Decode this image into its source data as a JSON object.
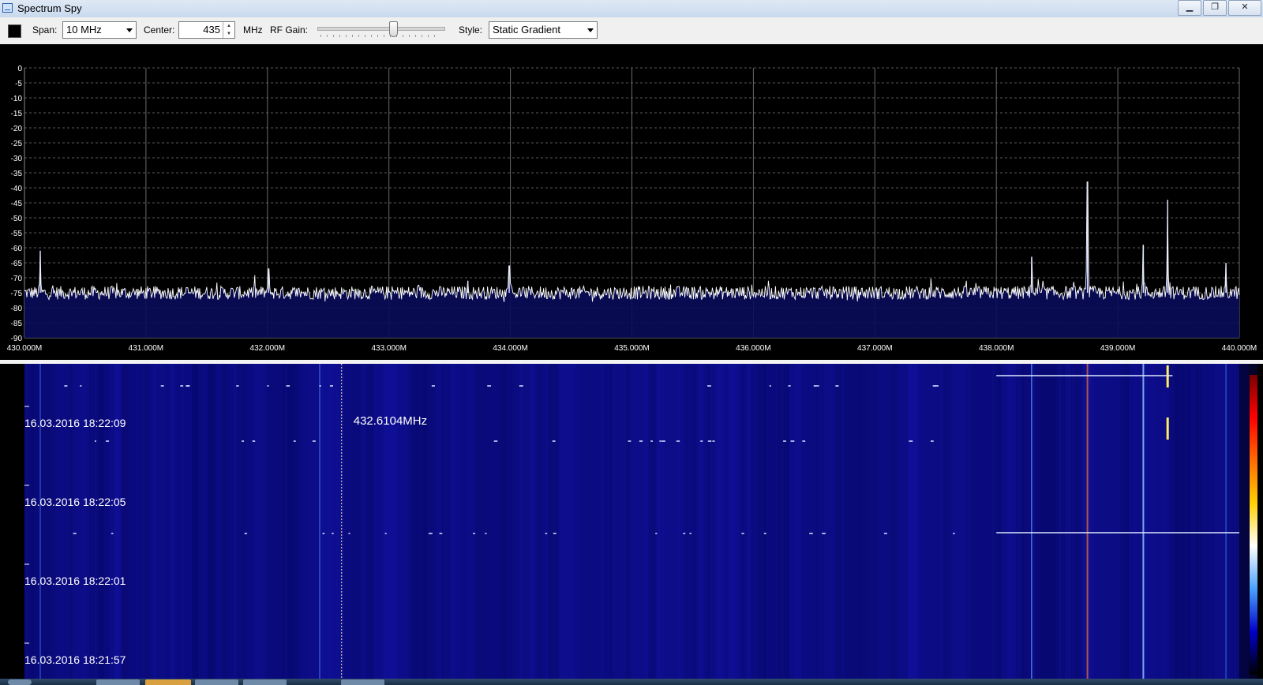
{
  "window": {
    "title": "Spectrum Spy",
    "buttons": {
      "minimize": "▁",
      "maximize": "❐",
      "close": "✕"
    }
  },
  "toolbar": {
    "span_label": "Span:",
    "span_value": "10 MHz",
    "center_label": "Center:",
    "center_value": "435",
    "center_unit": "MHz",
    "rf_gain_label": "RF Gain:",
    "rf_gain_level": 0.6,
    "style_label": "Style:",
    "style_value": "Static Gradient",
    "color_swatch": "#000000"
  },
  "chart_data": {
    "type": "line",
    "y_ticks": [
      "0",
      "-5",
      "-10",
      "-15",
      "-20",
      "-25",
      "-30",
      "-35",
      "-40",
      "-45",
      "-50",
      "-55",
      "-60",
      "-65",
      "-70",
      "-75",
      "-80",
      "-85",
      "-90"
    ],
    "ylim": [
      -90,
      0
    ],
    "x_ticks": [
      "430.000M",
      "431.000M",
      "432.000M",
      "433.000M",
      "434.000M",
      "435.000M",
      "436.000M",
      "437.000M",
      "438.000M",
      "439.000M",
      "440.000M"
    ],
    "xlim": [
      430.0,
      440.0
    ],
    "noise_floor_db": -75,
    "grid": true,
    "peaks": [
      {
        "freq": 430.13,
        "db": -61
      },
      {
        "freq": 432.01,
        "db": -67
      },
      {
        "freq": 433.65,
        "db": -71
      },
      {
        "freq": 433.99,
        "db": -66
      },
      {
        "freq": 438.29,
        "db": -63
      },
      {
        "freq": 438.75,
        "db": -38
      },
      {
        "freq": 439.21,
        "db": -59
      },
      {
        "freq": 439.41,
        "db": -44
      },
      {
        "freq": 439.89,
        "db": -65
      }
    ],
    "trace_color": "#ffffff",
    "fill_color": "#0a0c5a"
  },
  "waterfall": {
    "timestamps": [
      "16.03.2016 18:22:09",
      "16.03.2016 18:22:05",
      "16.03.2016 18:22:01",
      "16.03.2016 18:21:57"
    ],
    "cursor_label": "432.6104MHz",
    "background_color": "#0c0c82",
    "colorbar": [
      "#000000",
      "#0000c8",
      "#4aa0ff",
      "#ffffff",
      "#ffd000",
      "#ff6a00",
      "#ff0000",
      "#7a0000"
    ]
  }
}
